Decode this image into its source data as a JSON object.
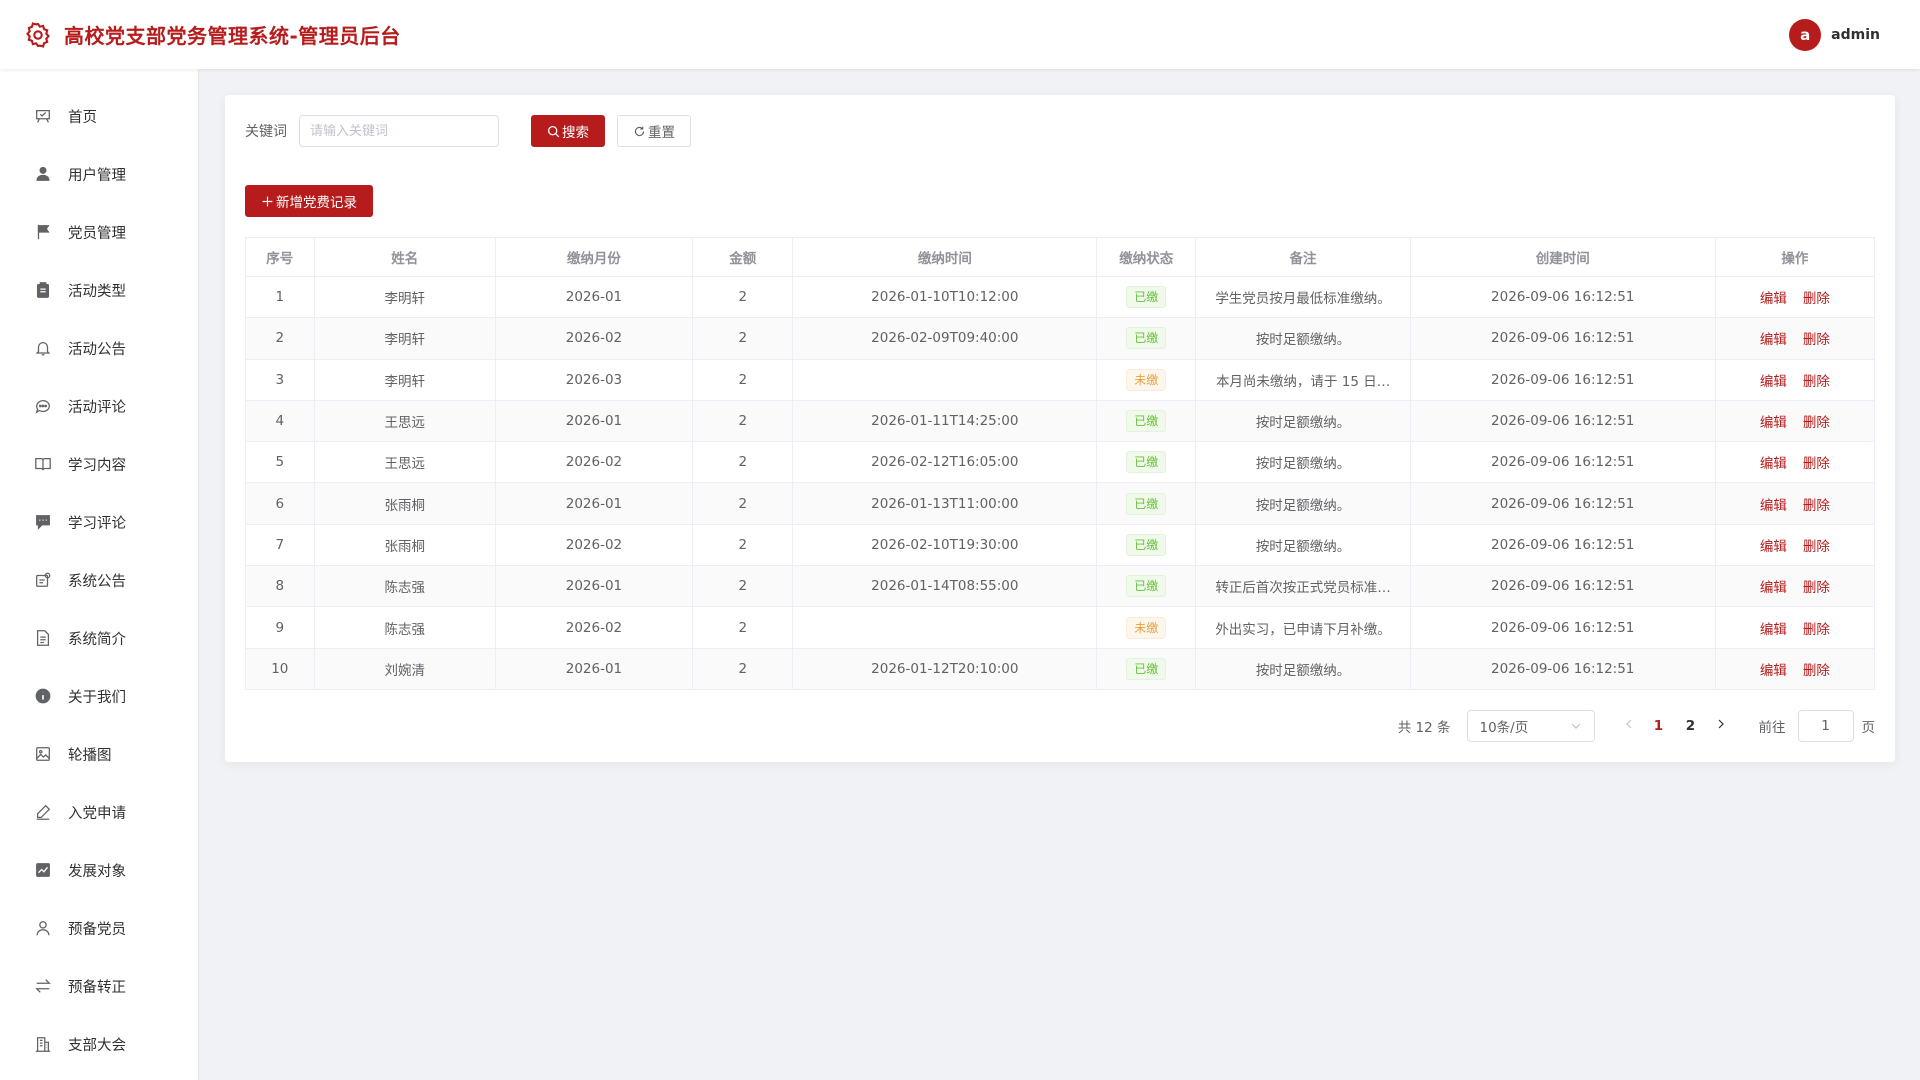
{
  "header": {
    "title": "高校党支部党务管理系统-管理员后台",
    "avatar_letter": "a",
    "username": "admin"
  },
  "sidebar": {
    "items": [
      {
        "label": "首页",
        "icon": "home-icon"
      },
      {
        "label": "用户管理",
        "icon": "user-icon"
      },
      {
        "label": "党员管理",
        "icon": "flag-icon"
      },
      {
        "label": "活动类型",
        "icon": "clipboard-icon"
      },
      {
        "label": "活动公告",
        "icon": "bell-icon"
      },
      {
        "label": "活动评论",
        "icon": "chat-icon"
      },
      {
        "label": "学习内容",
        "icon": "book-icon"
      },
      {
        "label": "学习评论",
        "icon": "comment-icon"
      },
      {
        "label": "系统公告",
        "icon": "notice-icon"
      },
      {
        "label": "系统简介",
        "icon": "document-icon"
      },
      {
        "label": "关于我们",
        "icon": "info-icon"
      },
      {
        "label": "轮播图",
        "icon": "picture-icon"
      },
      {
        "label": "入党申请",
        "icon": "pen-icon"
      },
      {
        "label": "发展对象",
        "icon": "trend-icon"
      },
      {
        "label": "预备党员",
        "icon": "person-icon"
      },
      {
        "label": "预备转正",
        "icon": "switch-icon"
      },
      {
        "label": "支部大会",
        "icon": "building-icon"
      }
    ]
  },
  "search": {
    "label": "关键词",
    "placeholder": "请输入关键词",
    "search_button": "搜索",
    "reset_button": "重置"
  },
  "add_button": "新增党费记录",
  "table": {
    "columns": [
      "序号",
      "姓名",
      "缴纳月份",
      "金额",
      "缴纳时间",
      "缴纳状态",
      "备注",
      "创建时间",
      "操作"
    ],
    "edit_label": "编辑",
    "delete_label": "删除",
    "rows": [
      {
        "no": "1",
        "name": "李明轩",
        "month": "2026-01",
        "amount": "2",
        "paid_time": "2026-01-10T10:12:00",
        "status": "已缴",
        "remark": "学生党员按月最低标准缴纳。",
        "created": "2026-09-06 16:12:51"
      },
      {
        "no": "2",
        "name": "李明轩",
        "month": "2026-02",
        "amount": "2",
        "paid_time": "2026-02-09T09:40:00",
        "status": "已缴",
        "remark": "按时足额缴纳。",
        "created": "2026-09-06 16:12:51"
      },
      {
        "no": "3",
        "name": "李明轩",
        "month": "2026-03",
        "amount": "2",
        "paid_time": "",
        "status": "未缴",
        "remark": "本月尚未缴纳，请于 15 日…",
        "created": "2026-09-06 16:12:51"
      },
      {
        "no": "4",
        "name": "王思远",
        "month": "2026-01",
        "amount": "2",
        "paid_time": "2026-01-11T14:25:00",
        "status": "已缴",
        "remark": "按时足额缴纳。",
        "created": "2026-09-06 16:12:51"
      },
      {
        "no": "5",
        "name": "王思远",
        "month": "2026-02",
        "amount": "2",
        "paid_time": "2026-02-12T16:05:00",
        "status": "已缴",
        "remark": "按时足额缴纳。",
        "created": "2026-09-06 16:12:51"
      },
      {
        "no": "6",
        "name": "张雨桐",
        "month": "2026-01",
        "amount": "2",
        "paid_time": "2026-01-13T11:00:00",
        "status": "已缴",
        "remark": "按时足额缴纳。",
        "created": "2026-09-06 16:12:51"
      },
      {
        "no": "7",
        "name": "张雨桐",
        "month": "2026-02",
        "amount": "2",
        "paid_time": "2026-02-10T19:30:00",
        "status": "已缴",
        "remark": "按时足额缴纳。",
        "created": "2026-09-06 16:12:51"
      },
      {
        "no": "8",
        "name": "陈志强",
        "month": "2026-01",
        "amount": "2",
        "paid_time": "2026-01-14T08:55:00",
        "status": "已缴",
        "remark": "转正后首次按正式党员标准…",
        "created": "2026-09-06 16:12:51"
      },
      {
        "no": "9",
        "name": "陈志强",
        "month": "2026-02",
        "amount": "2",
        "paid_time": "",
        "status": "未缴",
        "remark": "外出实习，已申请下月补缴。",
        "created": "2026-09-06 16:12:51"
      },
      {
        "no": "10",
        "name": "刘婉清",
        "month": "2026-01",
        "amount": "2",
        "paid_time": "2026-01-12T20:10:00",
        "status": "已缴",
        "remark": "按时足额缴纳。",
        "created": "2026-09-06 16:12:51"
      }
    ]
  },
  "pagination": {
    "total_text": "共 12 条",
    "page_size": "10条/页",
    "pages": [
      "1",
      "2"
    ],
    "goto_label": "前往",
    "goto_value": "1",
    "page_suffix": "页"
  },
  "colors": {
    "brand": "#b71c1c",
    "success": "#67c23a",
    "warning": "#e6a23c"
  }
}
